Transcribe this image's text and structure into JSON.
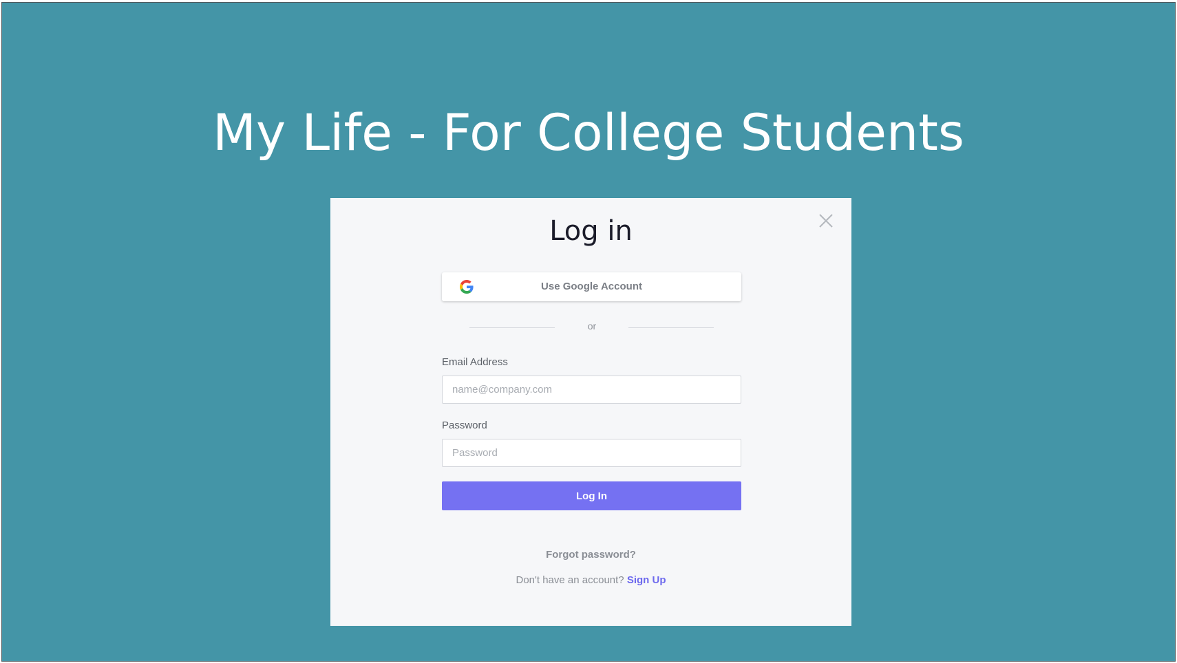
{
  "slide": {
    "title": "My Life - For College Students",
    "background_color": "#4495a7"
  },
  "modal": {
    "title": "Log in",
    "close_icon": "close-icon",
    "google_button": {
      "label": "Use Google Account",
      "icon": "google-icon"
    },
    "divider_text": "or",
    "email": {
      "label": "Email Address",
      "placeholder": "name@company.com",
      "value": ""
    },
    "password": {
      "label": "Password",
      "placeholder": "Password",
      "value": ""
    },
    "login_button": {
      "label": "Log In",
      "color": "#7571f2"
    },
    "forgot_password": "Forgot password?",
    "signup_prompt": "Don't have an account?",
    "signup_link": "Sign Up"
  }
}
